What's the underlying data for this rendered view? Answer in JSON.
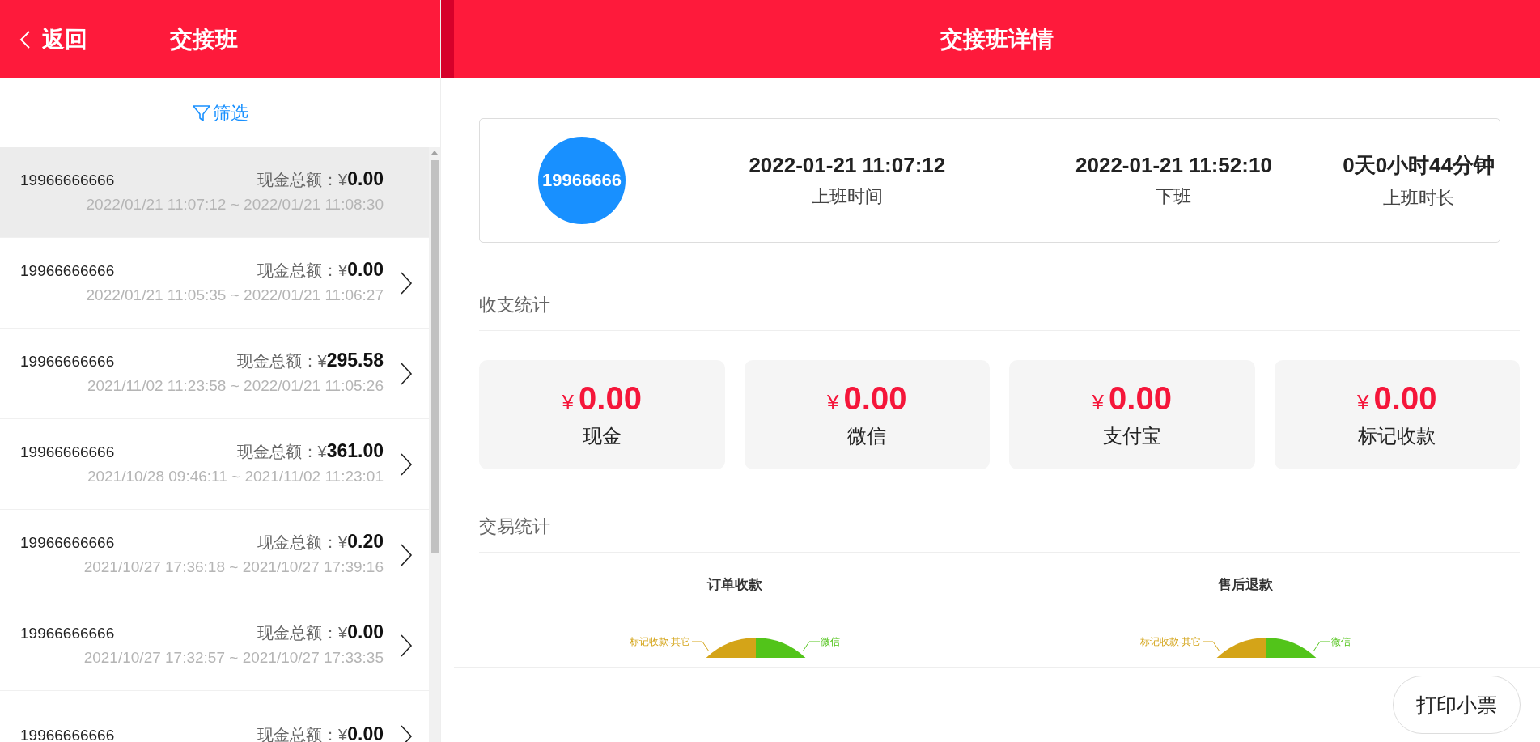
{
  "header": {
    "back_label": "返回",
    "left_title": "交接班",
    "right_title": "交接班详情"
  },
  "filter": {
    "label": "筛选"
  },
  "shifts": [
    {
      "phone": "19966666666",
      "amount_label": "现金总额：",
      "currency": "¥",
      "amount": "0.00",
      "period": "2022/01/21 11:07:12 ~ 2022/01/21 11:08:30",
      "selected": true
    },
    {
      "phone": "19966666666",
      "amount_label": "现金总额：",
      "currency": "¥",
      "amount": "0.00",
      "period": "2022/01/21 11:05:35 ~ 2022/01/21 11:06:27",
      "selected": false
    },
    {
      "phone": "19966666666",
      "amount_label": "现金总额：",
      "currency": "¥",
      "amount": "295.58",
      "period": "2021/11/02 11:23:58 ~ 2022/01/21 11:05:26",
      "selected": false
    },
    {
      "phone": "19966666666",
      "amount_label": "现金总额：",
      "currency": "¥",
      "amount": "361.00",
      "period": "2021/10/28 09:46:11 ~ 2021/11/02 11:23:01",
      "selected": false
    },
    {
      "phone": "19966666666",
      "amount_label": "现金总额：",
      "currency": "¥",
      "amount": "0.20",
      "period": "2021/10/27 17:36:18 ~ 2021/10/27 17:39:16",
      "selected": false
    },
    {
      "phone": "19966666666",
      "amount_label": "现金总额：",
      "currency": "¥",
      "amount": "0.00",
      "period": "2021/10/27 17:32:57 ~ 2021/10/27 17:33:35",
      "selected": false
    },
    {
      "phone": "19966666666",
      "amount_label": "现金总额：",
      "currency": "¥",
      "amount": "0.00",
      "selected": false
    }
  ],
  "shift_summary": {
    "avatar_text": "19966666",
    "items": [
      {
        "value": "2022-01-21 11:07:12",
        "label": "上班时间"
      },
      {
        "value": "2022-01-21 11:52:10",
        "label": "下班"
      },
      {
        "value": "0天0小时44分钟",
        "label": "上班时长"
      }
    ]
  },
  "income_stats": {
    "title": "收支统计",
    "items": [
      {
        "currency": "¥",
        "amount": "0.00",
        "label": "现金"
      },
      {
        "currency": "¥",
        "amount": "0.00",
        "label": "微信"
      },
      {
        "currency": "¥",
        "amount": "0.00",
        "label": "支付宝"
      },
      {
        "currency": "¥",
        "amount": "0.00",
        "label": "标记收款"
      }
    ]
  },
  "transaction_stats": {
    "title": "交易统计",
    "charts": [
      {
        "title": "订单收款",
        "labels": [
          {
            "text": "标记收款-其它",
            "color": "#d4a418"
          },
          {
            "text": "微信",
            "color": "#52c41a"
          }
        ]
      },
      {
        "title": "售后退款",
        "labels": [
          {
            "text": "标记收款-其它",
            "color": "#d4a418"
          },
          {
            "text": "微信",
            "color": "#52c41a"
          }
        ]
      }
    ]
  },
  "print_button": "打印小票"
}
